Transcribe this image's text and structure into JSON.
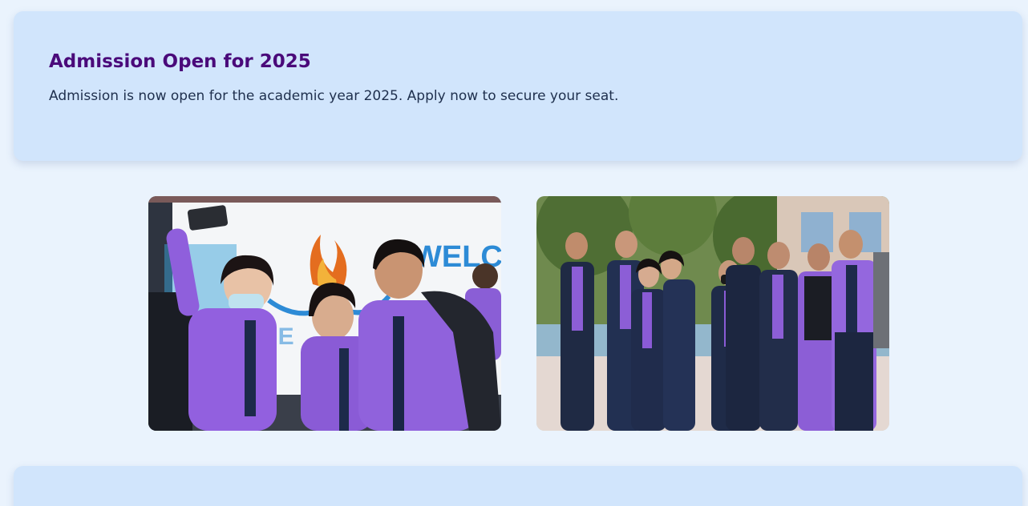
{
  "announcement": {
    "title": "Admission Open for 2025",
    "text": "Admission is now open for the academic year 2025. Apply now to secure your seat."
  },
  "gallery": {
    "images": [
      {
        "name": "students-selfie-photo",
        "banner_text": "WELC"
      },
      {
        "name": "students-group-photo"
      }
    ]
  },
  "colors": {
    "page_bg": "#eaf3fd",
    "card_bg": "#d1e5fc",
    "title": "#4a0a7a",
    "body_text": "#1e2f4d"
  }
}
